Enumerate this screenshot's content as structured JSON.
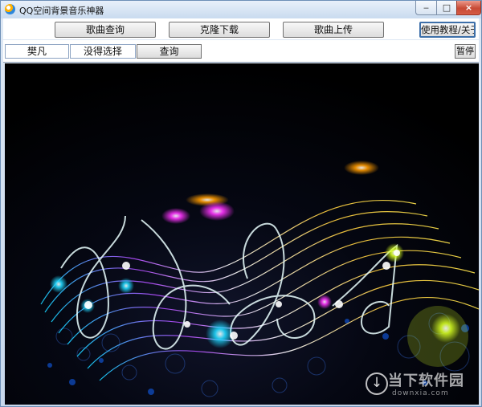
{
  "window": {
    "title": "QQ空间背景音乐神器",
    "controls": {
      "minimize": "‒",
      "maximize": "□",
      "close": "×"
    }
  },
  "toolbar": {
    "song_query": "歌曲查询",
    "clone_download": "克隆下载",
    "song_upload": "歌曲上传",
    "help_about": "使用教程/关于"
  },
  "search": {
    "artist_value": "樊凡",
    "song_value": "没得选择",
    "query_button": "查询",
    "pause_button": "暂停"
  },
  "watermark": {
    "brand": "当下软件园",
    "url": "downxia.com"
  },
  "icons": [
    "app-icon",
    "download-icon"
  ],
  "colors": {
    "title_bar": "#c9dbef",
    "window_border": "#6d8fb7",
    "button_border": "#707070",
    "help_border": "#3d6fa9",
    "background": "#000000"
  }
}
